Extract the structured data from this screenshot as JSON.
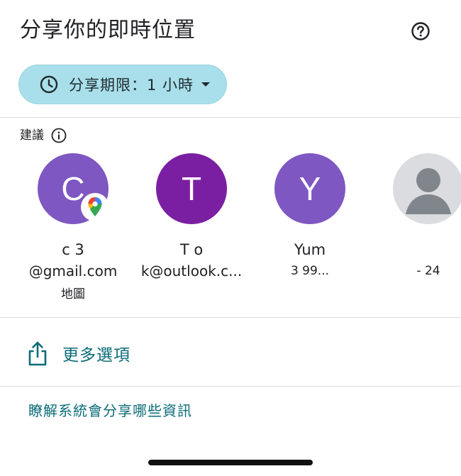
{
  "header": {
    "title": "分享你的即時位置",
    "help_icon": "help-circle-icon"
  },
  "duration_chip": {
    "label": "分享期限：1 小時",
    "icon": "clock-icon",
    "caret_icon": "caret-down-icon",
    "color": "#a8dfea"
  },
  "suggestions": {
    "label": "建議",
    "info_icon": "info-icon",
    "contacts": [
      {
        "initial": "C",
        "name": "c                         3",
        "detail": "@gmail.com",
        "extra": "地圖",
        "color": "#7e57c2",
        "badge": "google-maps-icon"
      },
      {
        "initial": "T",
        "name": "T                      o",
        "detail": "k@outlook.c...",
        "extra": "",
        "color": "#7b1fa2"
      },
      {
        "initial": "Y",
        "name": "Yum",
        "detail": "3              99...",
        "extra": "",
        "color": "#7e57c2"
      },
      {
        "initial": "",
        "name": "",
        "detail": "-                  24",
        "extra": "",
        "color": "#dadce0",
        "icon": "person-icon"
      }
    ]
  },
  "more_options": {
    "label": "更多選項",
    "icon": "share-icon"
  },
  "learn_more": {
    "label": "瞭解系統會分享哪些資訊"
  },
  "colors": {
    "accent": "#0b6b78",
    "divider": "#dadce0"
  }
}
